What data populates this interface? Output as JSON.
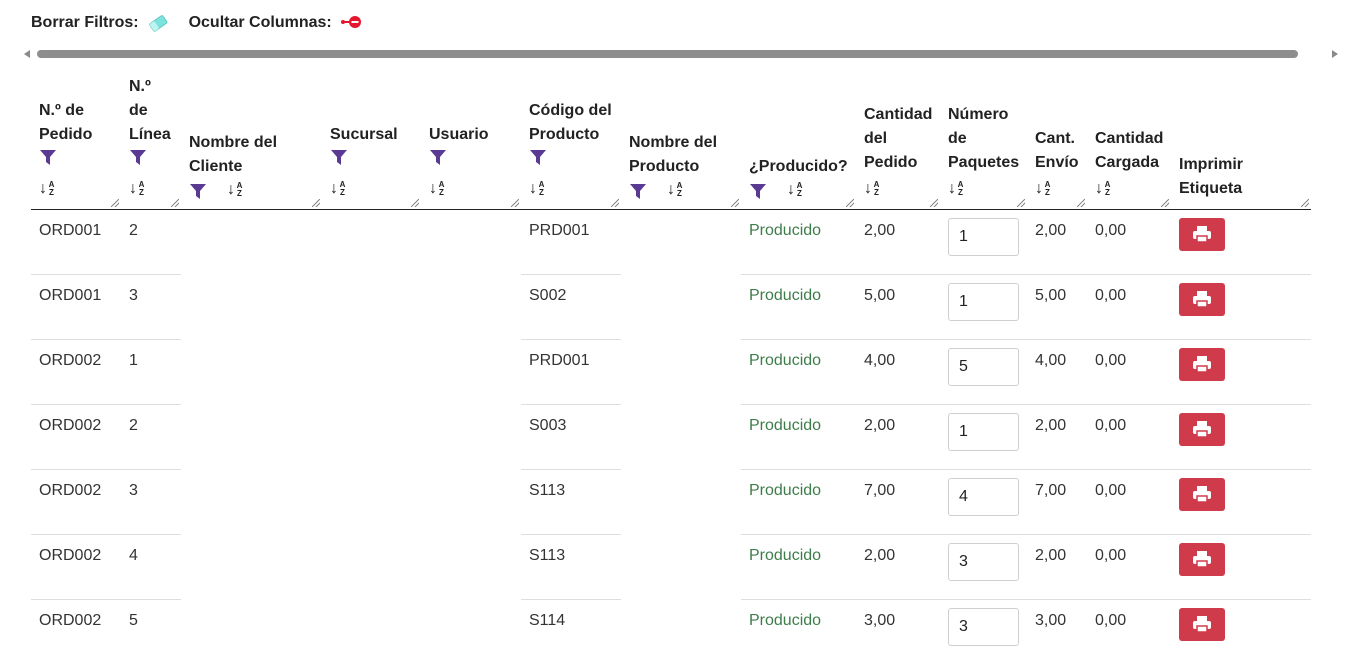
{
  "toolbar": {
    "clear_filters_label": "Borrar Filtros:",
    "hide_columns_label": "Ocultar Columnas:"
  },
  "colors": {
    "filter_icon": "#5b3a93",
    "eraser_icon": "#7ee3dd",
    "hide_icon": "#e3182d",
    "print_button": "#cf3b4b",
    "status_text": "#3d7d4a"
  },
  "columns": [
    {
      "label": "N.º de Pedido",
      "filter": true,
      "sort": true
    },
    {
      "label": "N.º de Línea",
      "filter": true,
      "sort": true
    },
    {
      "label": "Nombre del Cliente",
      "filter": true,
      "sort": true
    },
    {
      "label": "Sucursal",
      "filter": true,
      "sort": true
    },
    {
      "label": "Usuario",
      "filter": true,
      "sort": true
    },
    {
      "label": "Código del Producto",
      "filter": true,
      "sort": true
    },
    {
      "label": "Nombre del Producto",
      "filter": true,
      "sort": true
    },
    {
      "label": "¿Producido?",
      "filter": true,
      "sort": true
    },
    {
      "label": "Cantidad del Pedido",
      "filter": false,
      "sort": true
    },
    {
      "label": "Número de Paquetes",
      "filter": false,
      "sort": true
    },
    {
      "label": "Cant. Envío",
      "filter": false,
      "sort": true
    },
    {
      "label": "Cantidad Cargada",
      "filter": false,
      "sort": true
    },
    {
      "label": "Imprimir Etiqueta",
      "filter": false,
      "sort": false
    }
  ],
  "rows": [
    {
      "order": "ORD001",
      "line": "2",
      "client": "",
      "branch": "",
      "user": "",
      "product_code": "PRD001",
      "product_name": "",
      "produced": "Producido",
      "order_qty": "2,00",
      "packages": "1",
      "ship_qty": "2,00",
      "loaded_qty": "0,00"
    },
    {
      "order": "ORD001",
      "line": "3",
      "client": "",
      "branch": "",
      "user": "",
      "product_code": "S002",
      "product_name": "",
      "produced": "Producido",
      "order_qty": "5,00",
      "packages": "1",
      "ship_qty": "5,00",
      "loaded_qty": "0,00"
    },
    {
      "order": "ORD002",
      "line": "1",
      "client": "",
      "branch": "",
      "user": "",
      "product_code": "PRD001",
      "product_name": "",
      "produced": "Producido",
      "order_qty": "4,00",
      "packages": "5",
      "ship_qty": "4,00",
      "loaded_qty": "0,00"
    },
    {
      "order": "ORD002",
      "line": "2",
      "client": "",
      "branch": "",
      "user": "",
      "product_code": "S003",
      "product_name": "",
      "produced": "Producido",
      "order_qty": "2,00",
      "packages": "1",
      "ship_qty": "2,00",
      "loaded_qty": "0,00"
    },
    {
      "order": "ORD002",
      "line": "3",
      "client": "",
      "branch": "",
      "user": "",
      "product_code": "S113",
      "product_name": "",
      "produced": "Producido",
      "order_qty": "7,00",
      "packages": "4",
      "ship_qty": "7,00",
      "loaded_qty": "0,00"
    },
    {
      "order": "ORD002",
      "line": "4",
      "client": "",
      "branch": "",
      "user": "",
      "product_code": "S113",
      "product_name": "",
      "produced": "Producido",
      "order_qty": "2,00",
      "packages": "3",
      "ship_qty": "2,00",
      "loaded_qty": "0,00"
    },
    {
      "order": "ORD002",
      "line": "5",
      "client": "",
      "branch": "",
      "user": "",
      "product_code": "S114",
      "product_name": "",
      "produced": "Producido",
      "order_qty": "3,00",
      "packages": "3",
      "ship_qty": "3,00",
      "loaded_qty": "0,00"
    }
  ],
  "icons": {
    "clear_filters": "eraser-icon",
    "hide_columns": "hide-columns-icon",
    "filter": "filter-icon",
    "sort": "sort-az-icon",
    "print": "printer-icon"
  }
}
